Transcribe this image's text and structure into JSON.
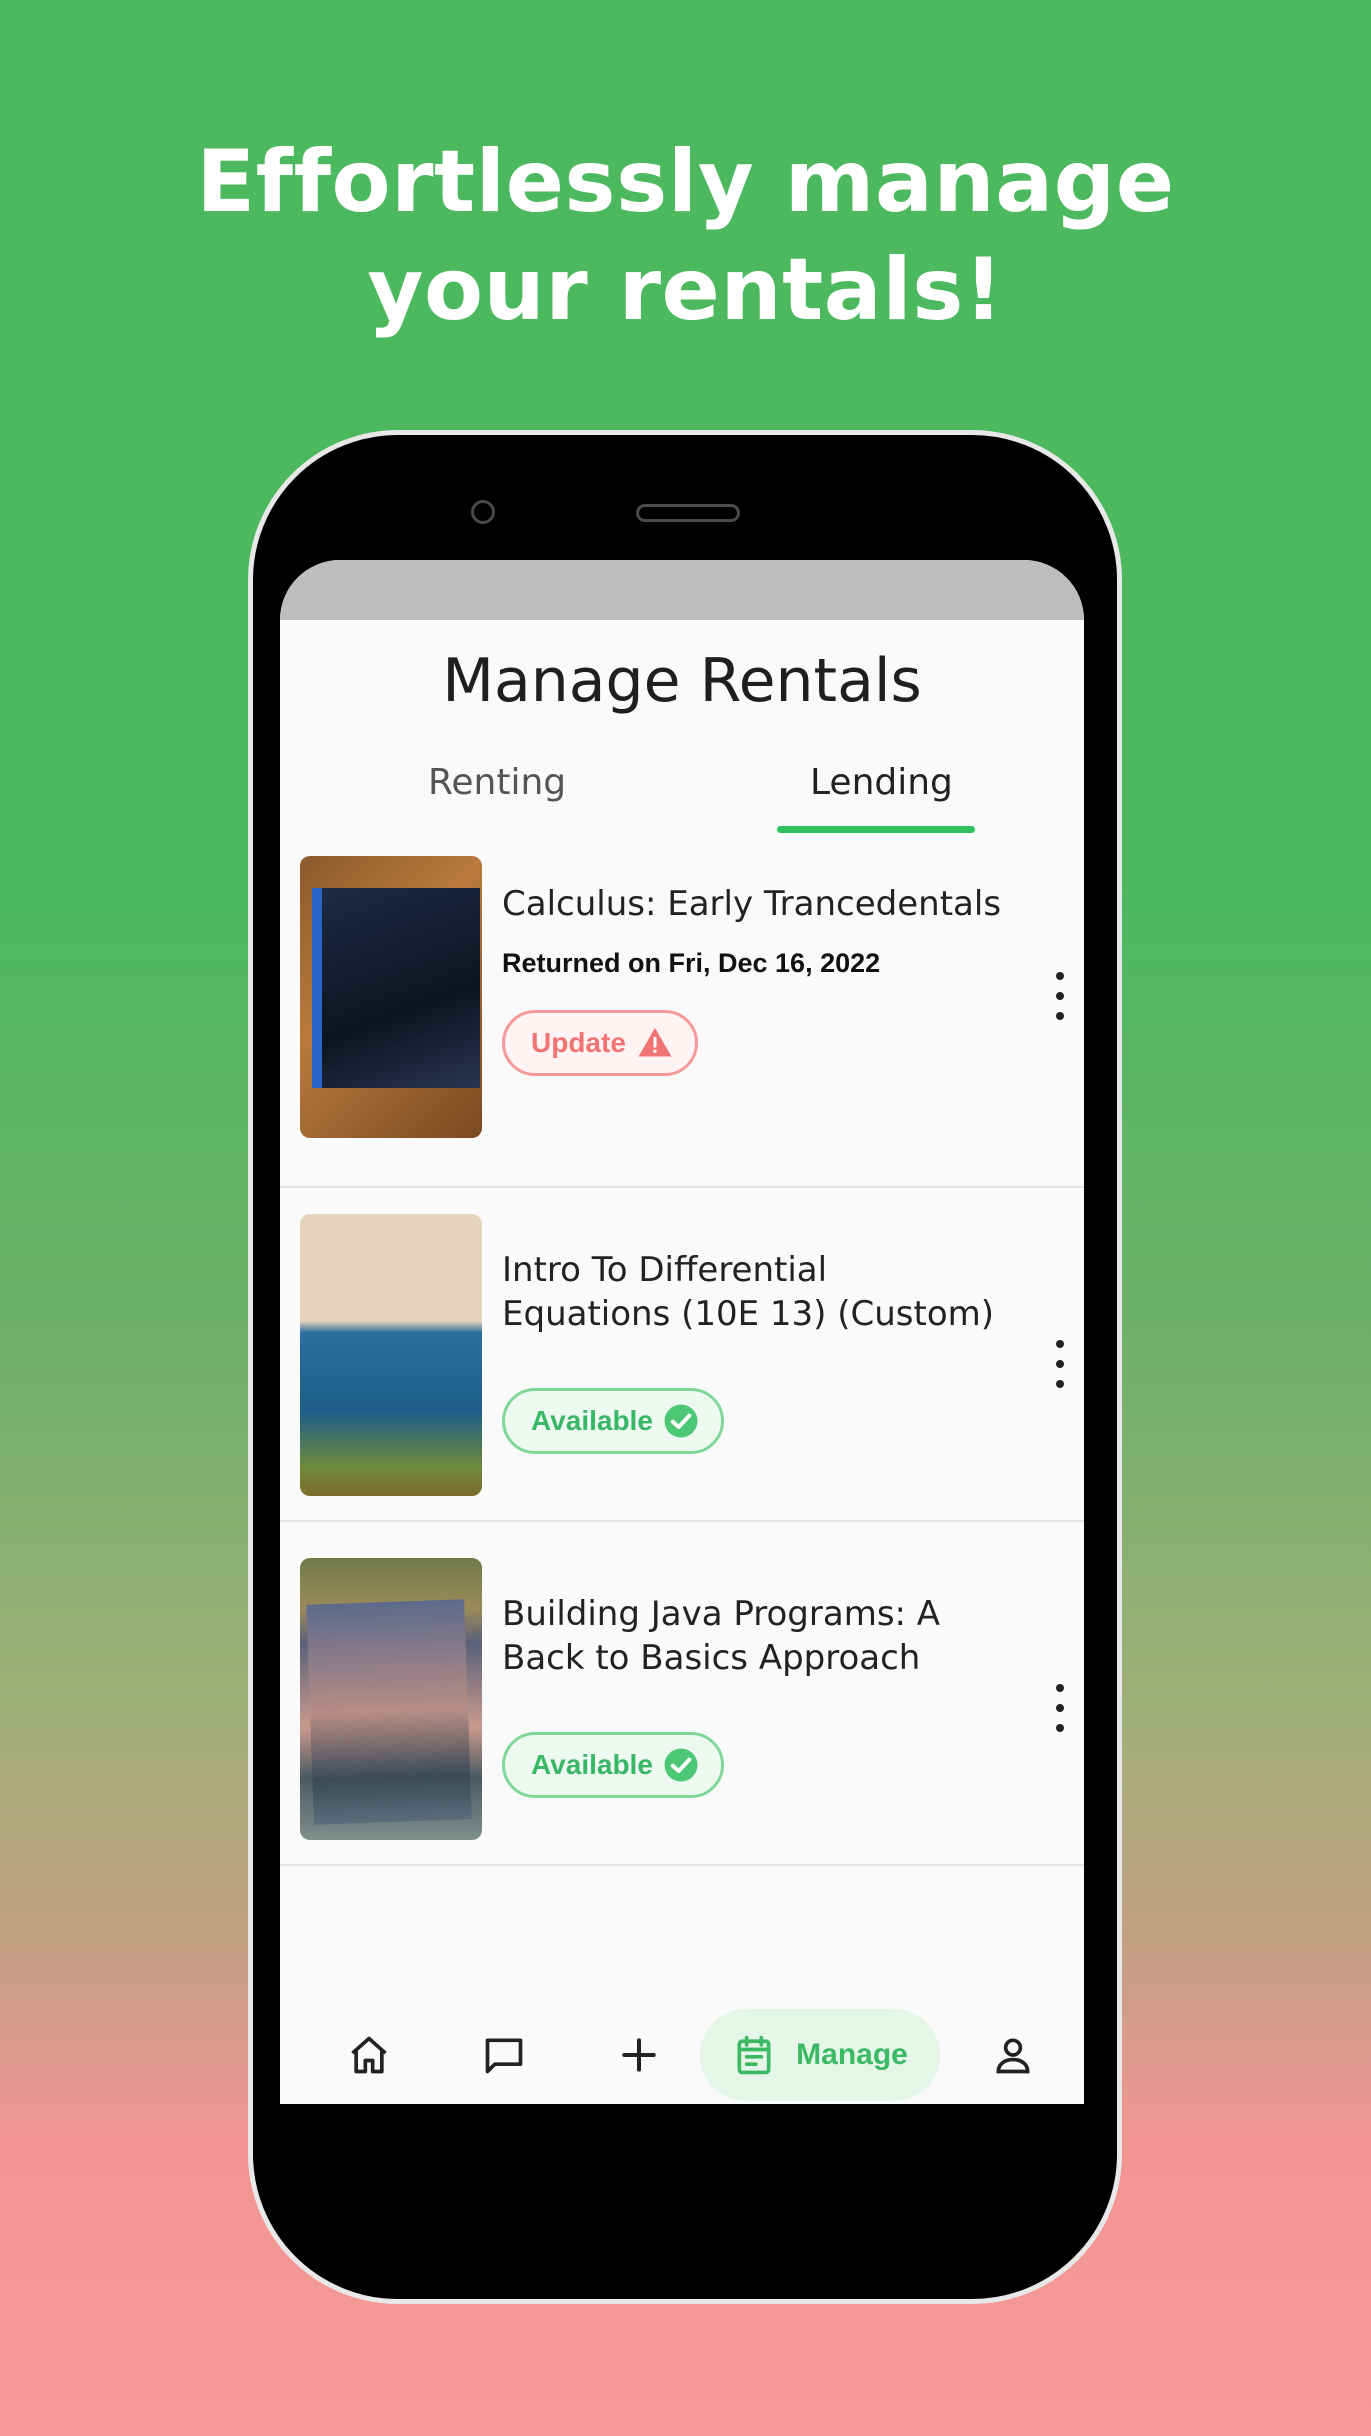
{
  "promo": {
    "headline_line1": "Effortlessly manage",
    "headline_line2": "your rentals!"
  },
  "page": {
    "title": "Manage Rentals"
  },
  "tabs": [
    {
      "label": "Renting",
      "active": false
    },
    {
      "label": "Lending",
      "active": true
    }
  ],
  "rentals": [
    {
      "title": "Calculus: Early Trancedentals",
      "subtitle": "Returned on Fri, Dec 16, 2022",
      "status_label": "Update",
      "status_icon": "warning-icon"
    },
    {
      "title": "Intro To Differential Equations (10E 13) (Custom)",
      "subtitle": "",
      "status_label": "Available",
      "status_icon": "check-circle-icon"
    },
    {
      "title": "Building Java Programs: A Back to Basics Approach",
      "subtitle": "",
      "status_label": "Available",
      "status_icon": "check-circle-icon"
    }
  ],
  "bottom_nav": {
    "home_icon": "home-icon",
    "chat_icon": "chat-icon",
    "add_icon": "add-icon",
    "manage_label": "Manage",
    "manage_icon": "calendar-icon",
    "profile_icon": "profile-icon"
  },
  "colors": {
    "accent_green": "#2fbf5e",
    "warning_red": "#f07474",
    "available_green": "#38b765"
  }
}
